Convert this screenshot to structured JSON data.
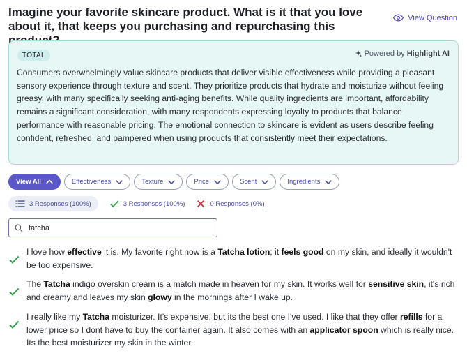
{
  "question": {
    "title": "Imagine your favorite skincare product. What is it that you love about it, that keeps you purchasing and repurchasing this product?",
    "view_label": "View Question"
  },
  "summary": {
    "badge": "TOTAL",
    "powered_prefix": "Powered by",
    "powered_brand": "Highlight AI",
    "text": "Consumers overwhelmingly value skincare products that deliver visible effectiveness while providing a pleasant sensory experience through texture and scent. They prioritize products that hydrate and moisturize without feeling greasy, with many specifically seeking anti-aging benefits. While quality ingredients are important, affordability remains a significant consideration, with many respondents expressing loyalty to products that balance performance with reasonable pricing. The emotional connection to skincare is evident as users describe feeling confident, refreshed, and pampered when using products that consistently meet their expectations."
  },
  "filters": [
    {
      "label": "View All",
      "active": true,
      "icon": "chevron-up-icon"
    },
    {
      "label": "Effectiveness",
      "active": false,
      "icon": "chevron-down-icon"
    },
    {
      "label": "Texture",
      "active": false,
      "icon": "chevron-down-icon"
    },
    {
      "label": "Price",
      "active": false,
      "icon": "chevron-down-icon"
    },
    {
      "label": "Scent",
      "active": false,
      "icon": "chevron-down-icon"
    },
    {
      "label": "Ingredients",
      "active": false,
      "icon": "chevron-down-icon"
    }
  ],
  "stats": {
    "all": "3 Responses (100%)",
    "positive": "3 Responses (100%)",
    "negative": "0 Responses (0%)"
  },
  "search": {
    "value": "tatcha",
    "placeholder": ""
  },
  "responses": [
    {
      "segments": [
        {
          "t": "I love how ",
          "b": false
        },
        {
          "t": "effective",
          "b": true
        },
        {
          "t": " it is. My favorite right now is a ",
          "b": false
        },
        {
          "t": "Tatcha lotion",
          "b": true
        },
        {
          "t": "; it ",
          "b": false
        },
        {
          "t": "feels good",
          "b": true
        },
        {
          "t": " on my skin, and ideally it wouldn't be too expensive.",
          "b": false
        }
      ]
    },
    {
      "segments": [
        {
          "t": "The ",
          "b": false
        },
        {
          "t": "Tatcha",
          "b": true
        },
        {
          "t": " indigo overskin cream is a match made in heaven for my skin. It works well for ",
          "b": false
        },
        {
          "t": "sensitive skin",
          "b": true
        },
        {
          "t": ", it's rich and creamy and leaves my skin ",
          "b": false
        },
        {
          "t": "glowy",
          "b": true
        },
        {
          "t": " in the mornings after I wake up.",
          "b": false
        }
      ]
    },
    {
      "segments": [
        {
          "t": "I really like my ",
          "b": false
        },
        {
          "t": "Tatcha",
          "b": true
        },
        {
          "t": " moisturizer. It's expensive, but its the best one I've used. I like that they offer ",
          "b": false
        },
        {
          "t": "refills",
          "b": true
        },
        {
          "t": " for a lower price so I dont have to buy the container again. It also comes with an ",
          "b": false
        },
        {
          "t": "applicator spoon",
          "b": true
        },
        {
          "t": " which is really nice. Its the best moisturizer my skin in the winter.",
          "b": false
        }
      ]
    }
  ],
  "colors": {
    "accent": "#5b57c9",
    "card_bg": "#e7f7f6",
    "check_green": "#2f9e44",
    "cross_red": "#d6293e"
  }
}
